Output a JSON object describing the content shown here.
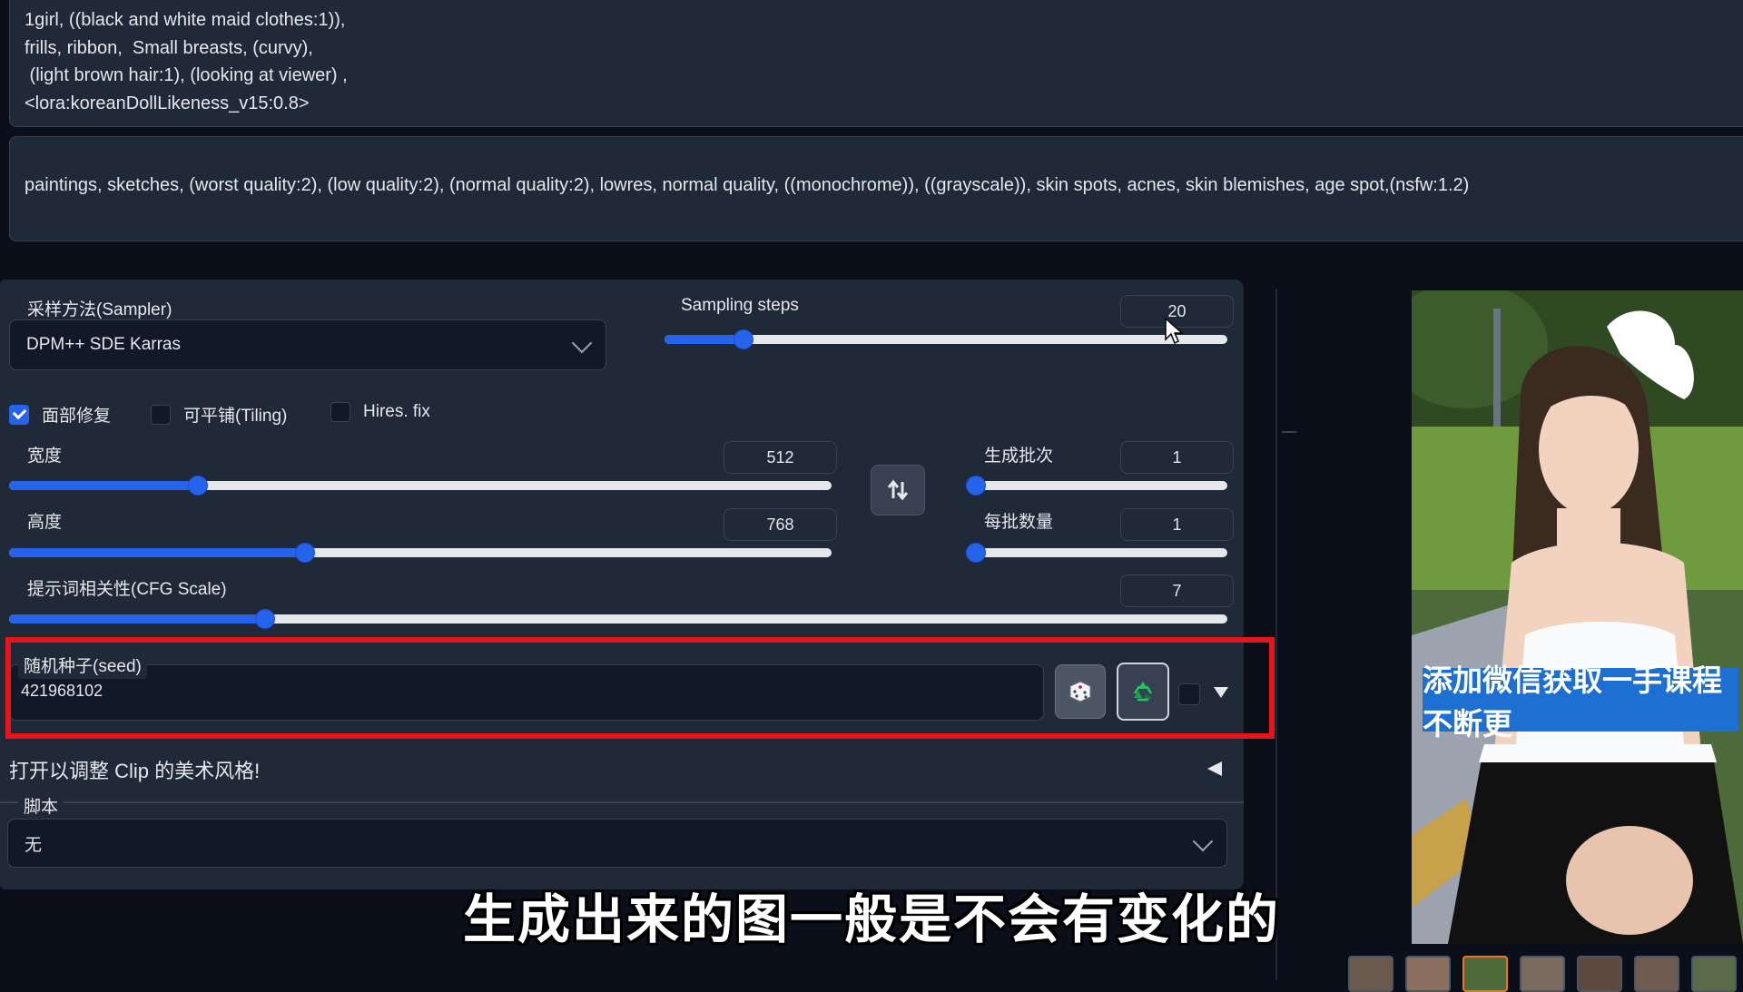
{
  "prompts": {
    "positive_lines": [
      "1girl, ((black and white maid clothes:1)),",
      "frills, ribbon,  Small breasts, (curvy),",
      " (light brown hair:1), (looking at viewer) ,",
      "<lora:koreanDollLikeness_v15:0.8>"
    ],
    "negative": "paintings, sketches, (worst quality:2), (low quality:2), (normal quality:2), lowres, normal quality, ((monochrome)), ((grayscale)), skin spots, acnes, skin blemishes, age spot,(nsfw:1.2)"
  },
  "sampler": {
    "label": "采样方法(Sampler)",
    "value": "DPM++ SDE Karras"
  },
  "steps": {
    "label": "Sampling steps",
    "value": "20",
    "fraction": 0.14
  },
  "checks": [
    {
      "label": "面部修复",
      "checked": true
    },
    {
      "label": "可平铺(Tiling)",
      "checked": false
    },
    {
      "label": "Hires. fix",
      "checked": false
    }
  ],
  "width": {
    "label": "宽度",
    "value": "512",
    "fraction": 0.23
  },
  "height": {
    "label": "高度",
    "value": "768",
    "fraction": 0.36
  },
  "batch_count": {
    "label": "生成批次",
    "value": "1",
    "fraction": 0.0
  },
  "batch_size": {
    "label": "每批数量",
    "value": "1",
    "fraction": 0.0
  },
  "cfg": {
    "label": "提示词相关性(CFG Scale)",
    "value": "7",
    "fraction": 0.21
  },
  "seed": {
    "label": "随机种子(seed)",
    "value": "421968102"
  },
  "clip_style": "打开以调整 Clip 的美术风格!",
  "script": {
    "label": "脚本",
    "value": "无"
  },
  "subtitle": "生成出来的图一般是不会有变化的",
  "watermark": "添加微信获取一手课程不断更",
  "icons": {
    "swap": "swap-arrows-icon",
    "dice": "dice-icon",
    "recycle": "recycle-icon",
    "collapse": "triangle-left-icon",
    "extra": "triangle-down-icon"
  }
}
